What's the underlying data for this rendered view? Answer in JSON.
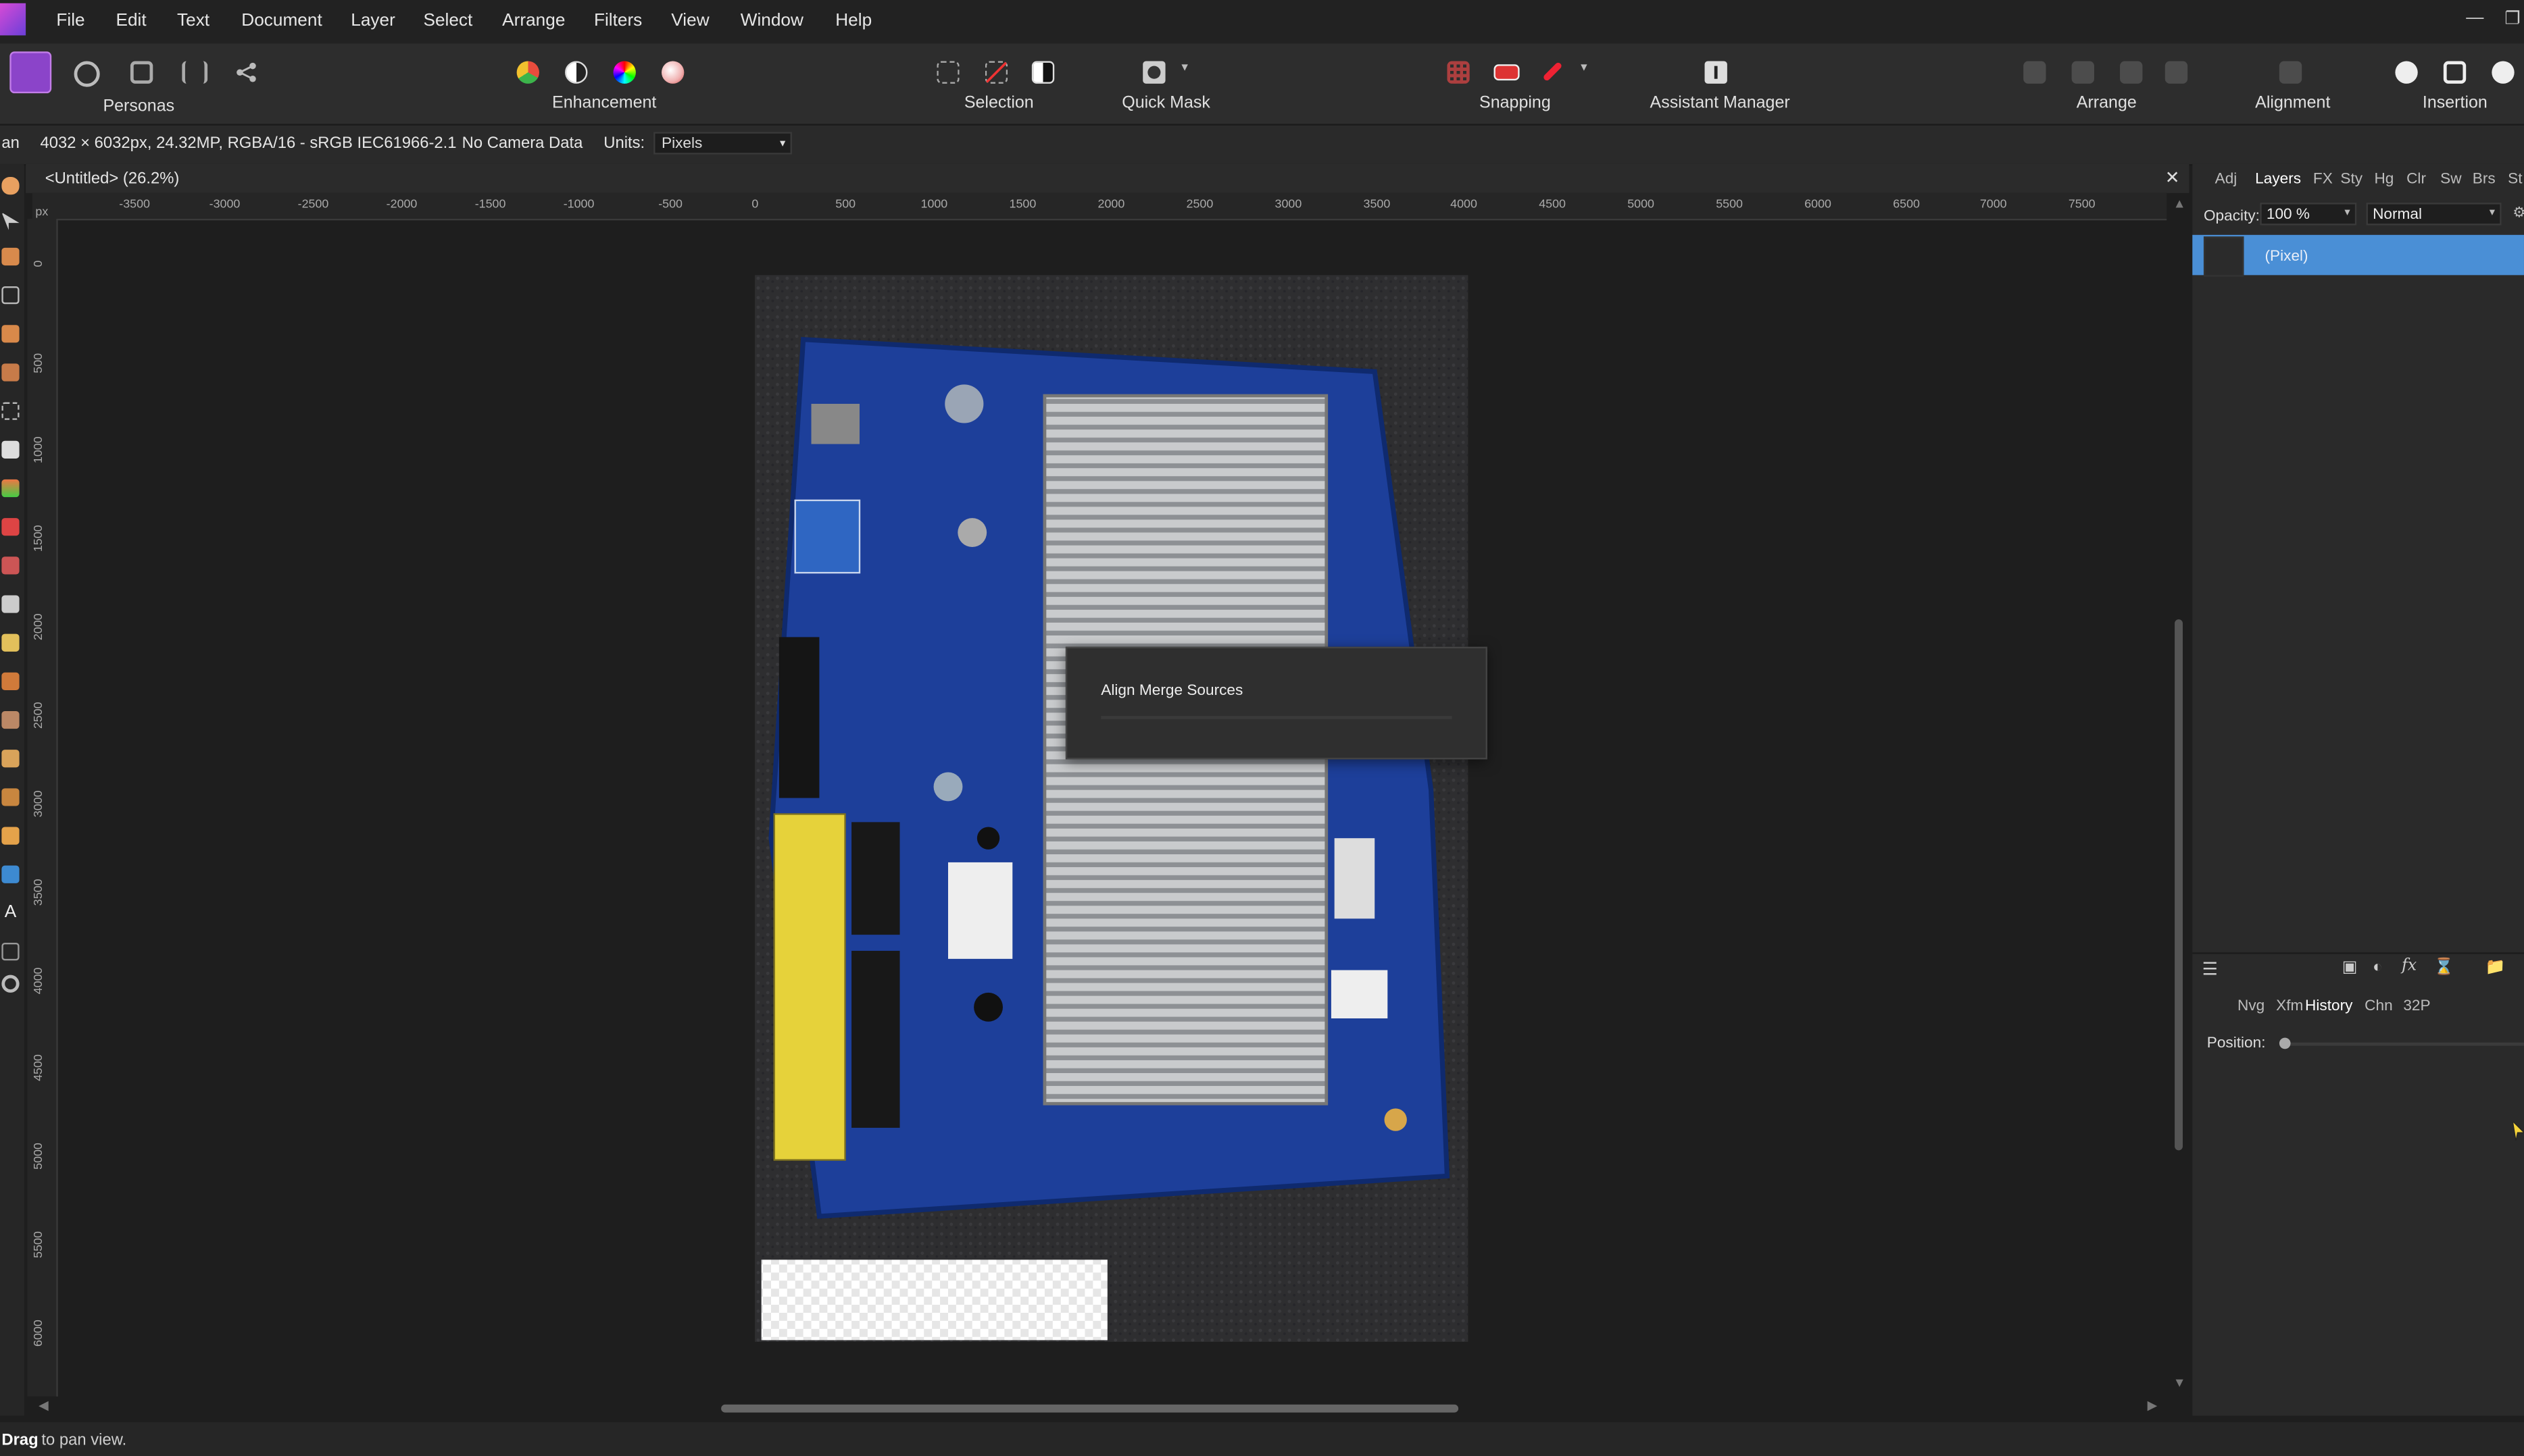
{
  "app": {
    "menu": [
      "File",
      "Edit",
      "Text",
      "Document",
      "Layer",
      "Select",
      "Arrange",
      "Filters",
      "View",
      "Window",
      "Help"
    ]
  },
  "toolbar": {
    "groups": {
      "personas": "Personas",
      "enhancement": "Enhancement",
      "selection": "Selection",
      "quick_mask": "Quick Mask",
      "snapping": "Snapping",
      "assistant_manager": "Assistant Manager",
      "arrange": "Arrange",
      "alignment": "Alignment",
      "insertion": "Insertion"
    }
  },
  "context_bar": {
    "tool_prefix": "an",
    "doc_info": "4032 × 6032px, 24.32MP, RGBA/16 - sRGB IEC61966-2.1",
    "camera": "No Camera Data",
    "units_label": "Units:",
    "units_value": "Pixels"
  },
  "document": {
    "tab_title": "<Untitled> (26.2%)"
  },
  "rulers": {
    "unit": "px",
    "top_ticks": [
      "-3500",
      "-3000",
      "-2500",
      "-2000",
      "-1500",
      "-1000",
      "-500",
      "0",
      "500",
      "1000",
      "1500",
      "2000",
      "2500",
      "3000",
      "3500",
      "4000",
      "4500",
      "5000",
      "5500",
      "6000",
      "6500",
      "7000",
      "7500"
    ],
    "left_ticks": [
      "0",
      "500",
      "1000",
      "1500",
      "2000",
      "2500",
      "3000",
      "3500",
      "4000",
      "4500",
      "5000",
      "5500",
      "6000"
    ]
  },
  "dialog": {
    "title": "Align Merge Sources"
  },
  "right_panel": {
    "top_tabs": [
      "Adj",
      "Layers",
      "FX",
      "Sty",
      "Hg",
      "Clr",
      "Sw",
      "Brs",
      "St"
    ],
    "active_top_tab": "Layers",
    "opacity_label": "Opacity:",
    "opacity_value": "100 %",
    "blend_mode": "Normal",
    "layer_name": "(Pixel)",
    "bottom_tabs": [
      "Nvg",
      "Xfm",
      "History",
      "Chn",
      "32P"
    ],
    "active_bottom_tab": "History",
    "position_label": "Position:"
  },
  "status": {
    "action": "Drag",
    "hint": " to pan view."
  },
  "colors": {
    "accent": "#3d80c9",
    "layer_selected": "#4a8fd6"
  }
}
